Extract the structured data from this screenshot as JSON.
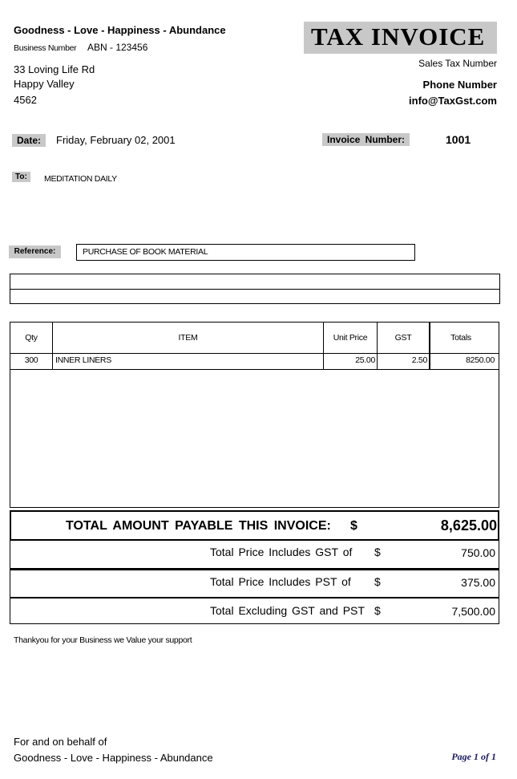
{
  "header": {
    "company_name": "Goodness - Love - Happiness - Abundance",
    "business_number_label": "Business Number",
    "business_number": "ABN - 123456",
    "address": [
      "33 Loving Life Rd",
      "Happy Valley",
      "4562"
    ],
    "title": "TAX INVOICE",
    "sales_tax_number_label": "Sales Tax Number",
    "phone_label": "Phone Number",
    "email": "info@TaxGst.com"
  },
  "invoice": {
    "date_label": "Date:",
    "date": "Friday, February 02, 2001",
    "number_label": "Invoice  Number:",
    "number": "1001",
    "to_label": "To:",
    "to": "MEDITATION DAILY",
    "reference_label": "Reference:",
    "reference": "PURCHASE OF BOOK MATERIAL"
  },
  "table": {
    "columns": [
      "Qty",
      "ITEM",
      "Unit Price",
      "GST",
      "Totals"
    ],
    "rows": [
      {
        "qty": "300",
        "item": "INNER LINERS",
        "unit_price": "25.00",
        "gst": "2.50",
        "total": "8250.00"
      }
    ]
  },
  "totals": {
    "grand_label": "TOTAL  AMOUNT  PAYABLE  THIS  INVOICE:",
    "currency": "$",
    "grand_value": "8,625.00",
    "gst_label": "Total Price Includes  GST  of",
    "gst_value": "750.00",
    "pst_label": "Total Price Includes  PST  of",
    "pst_value": "375.00",
    "excl_label": "Total Excluding GST  and  PST",
    "excl_value": "7,500.00"
  },
  "footer": {
    "thanks": "Thankyou for your Business we Value your support",
    "behalf_line1": "For and on behalf of",
    "behalf_line2": "Goodness - Love - Happiness - Abundance",
    "page": "Page 1 of 1"
  }
}
